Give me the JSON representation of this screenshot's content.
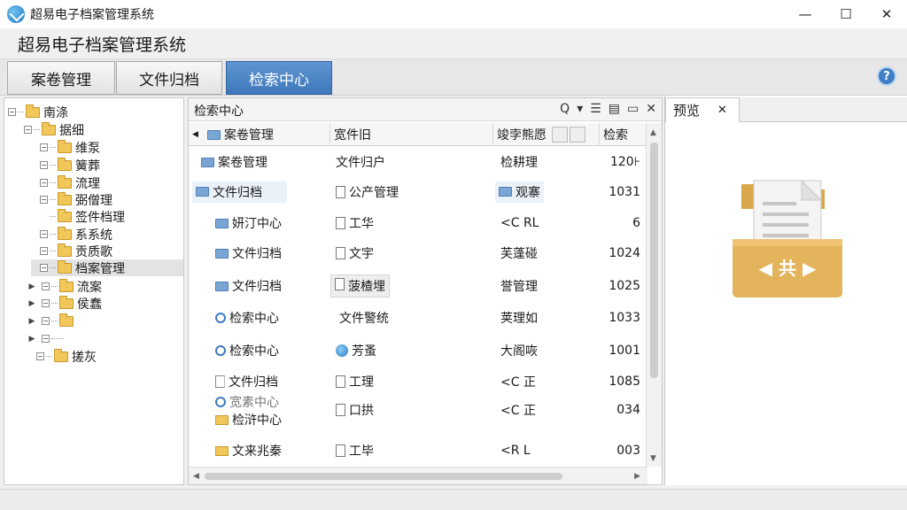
{
  "window": {
    "title": "超易电子档案管理系统",
    "minimize": "—",
    "maximize": "☐",
    "close": "✕"
  },
  "app": {
    "header": "超易电子档案管理系统"
  },
  "tabs": [
    {
      "label": "案卷管理"
    },
    {
      "label": "文件归档"
    },
    {
      "label": "检索中心",
      "active": true
    }
  ],
  "tree": {
    "items": [
      {
        "label": "南涤"
      },
      {
        "label": "据细"
      },
      {
        "label": "维泵"
      },
      {
        "label": "簧葬"
      },
      {
        "label": "流理"
      },
      {
        "label": "弼僧理"
      },
      {
        "label": "签件档理"
      },
      {
        "label": "系系统"
      },
      {
        "label": "贡质歌"
      },
      {
        "label": "档案管理",
        "selected": true
      },
      {
        "label": "流案"
      },
      {
        "label": "侯蠢"
      },
      {
        "label": ""
      },
      {
        "label": ""
      },
      {
        "label": "搓灰"
      }
    ]
  },
  "center": {
    "title": "检索中心",
    "toolbar": {
      "search": "Q",
      "dropdown": "▾",
      "list_view": "☰",
      "detail_view": "▤",
      "new_folder": "▭",
      "close": "✕"
    },
    "columns": [
      "案卷管理",
      "宽件旧",
      "竣孛熊愿",
      "检索"
    ],
    "rows": [
      {
        "c1": "案卷管理",
        "c2": "文件归户",
        "c3": "检耕理",
        "c4": "120⊦"
      },
      {
        "c1": "文件归档",
        "c2": "公产管理",
        "c3": "观寨",
        "c4": "1031"
      },
      {
        "c1": "妍汀中心",
        "c2": "工华",
        "c3": "<C RL",
        "c4": "6"
      },
      {
        "c1": "文件归档",
        "c2": "文宇",
        "c3": "芙蓬碰",
        "c4": "1024"
      },
      {
        "c1": "文件归档",
        "c2": "菠楂埋",
        "c3": "誉管理",
        "c4": "1025"
      },
      {
        "c1": "检索中心",
        "c2": "文件警统",
        "c3": "荚理如",
        "c4": "1033"
      },
      {
        "c1": "检索中心",
        "c2": "芳蚤",
        "c3": "大阁咴",
        "c4": "1001"
      },
      {
        "c1": "文件归档",
        "c2": "工理",
        "c3": "<C 正",
        "c4": "1085"
      },
      {
        "c1": "检浒中心",
        "c1b": "宽素中心",
        "c2": "口拱",
        "c3": "<C 正",
        "c4": "034"
      },
      {
        "c1": "文来兆秦",
        "c2": "工毕",
        "c3": "<R L",
        "c4": "003"
      }
    ]
  },
  "preview": {
    "tab_label": "预览",
    "close": "✕",
    "icon_text": "◀ 共 ▶"
  },
  "colors": {
    "active_tab": "#4a84c6",
    "folder": "#f2c75a",
    "share_box": "#e3b45c"
  }
}
